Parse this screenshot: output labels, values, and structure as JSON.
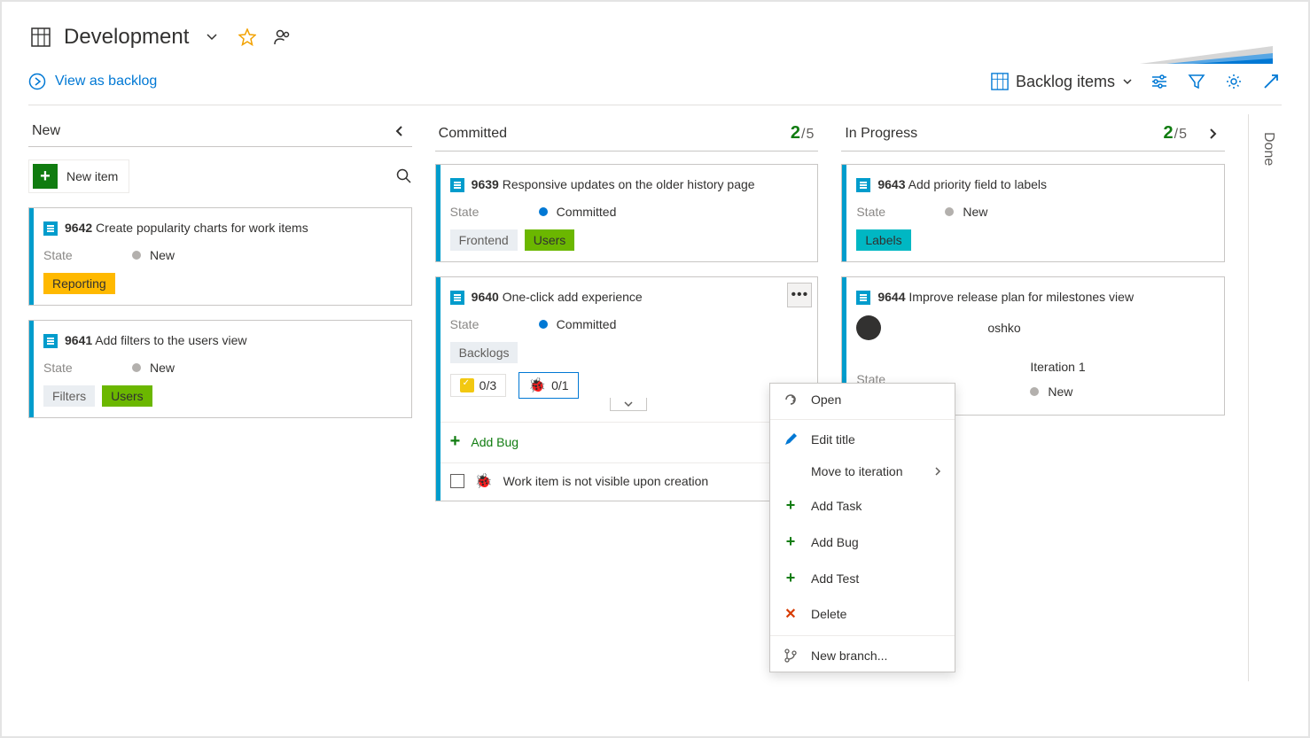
{
  "header": {
    "title": "Development",
    "view_link": "View as backlog",
    "backlog_selector": "Backlog items"
  },
  "columns": {
    "new": {
      "title": "New",
      "new_item_label": "New item"
    },
    "committed": {
      "title": "Committed",
      "wip_current": "2",
      "wip_limit": "/5"
    },
    "in_progress": {
      "title": "In Progress",
      "wip_current": "2",
      "wip_limit": "/5"
    },
    "done": {
      "title": "Done"
    }
  },
  "cards": {
    "c9642": {
      "id": "9642",
      "title": "Create popularity charts for work items",
      "state_label": "State",
      "state_value": "New",
      "tags": [
        {
          "text": "Reporting",
          "cls": "tag-yellow"
        }
      ]
    },
    "c9641": {
      "id": "9641",
      "title": "Add filters to the users view",
      "state_label": "State",
      "state_value": "New",
      "tags": [
        {
          "text": "Filters",
          "cls": "tag-gray"
        },
        {
          "text": "Users",
          "cls": "tag-green"
        }
      ]
    },
    "c9639": {
      "id": "9639",
      "title": "Responsive updates on the older history page",
      "state_label": "State",
      "state_value": "Committed",
      "tags": [
        {
          "text": "Frontend",
          "cls": "tag-gray"
        },
        {
          "text": "Users",
          "cls": "tag-green"
        }
      ]
    },
    "c9640": {
      "id": "9640",
      "title": "One-click add experience",
      "state_label": "State",
      "state_value": "Committed",
      "tags": [
        {
          "text": "Backlogs",
          "cls": "tag-gray"
        }
      ],
      "task_count": "0/3",
      "bug_count": "0/1",
      "add_bug_label": "Add Bug",
      "child_item": "Work item is not visible upon creation"
    },
    "c9643": {
      "id": "9643",
      "title": "Add priority field to labels",
      "state_label": "State",
      "state_value": "New",
      "tags": [
        {
          "text": "Labels",
          "cls": "tag-cyan"
        }
      ]
    },
    "c9644": {
      "id": "9644",
      "title": "Improve release plan for milestones view",
      "assignee_partial": "oshko",
      "state_label": "State",
      "state_value": "New",
      "iteration": "Iteration 1"
    }
  },
  "context_menu": {
    "open": "Open",
    "edit_title": "Edit title",
    "move_to_iteration": "Move to iteration",
    "add_task": "Add Task",
    "add_bug": "Add Bug",
    "add_test": "Add Test",
    "delete": "Delete",
    "new_branch": "New branch..."
  }
}
